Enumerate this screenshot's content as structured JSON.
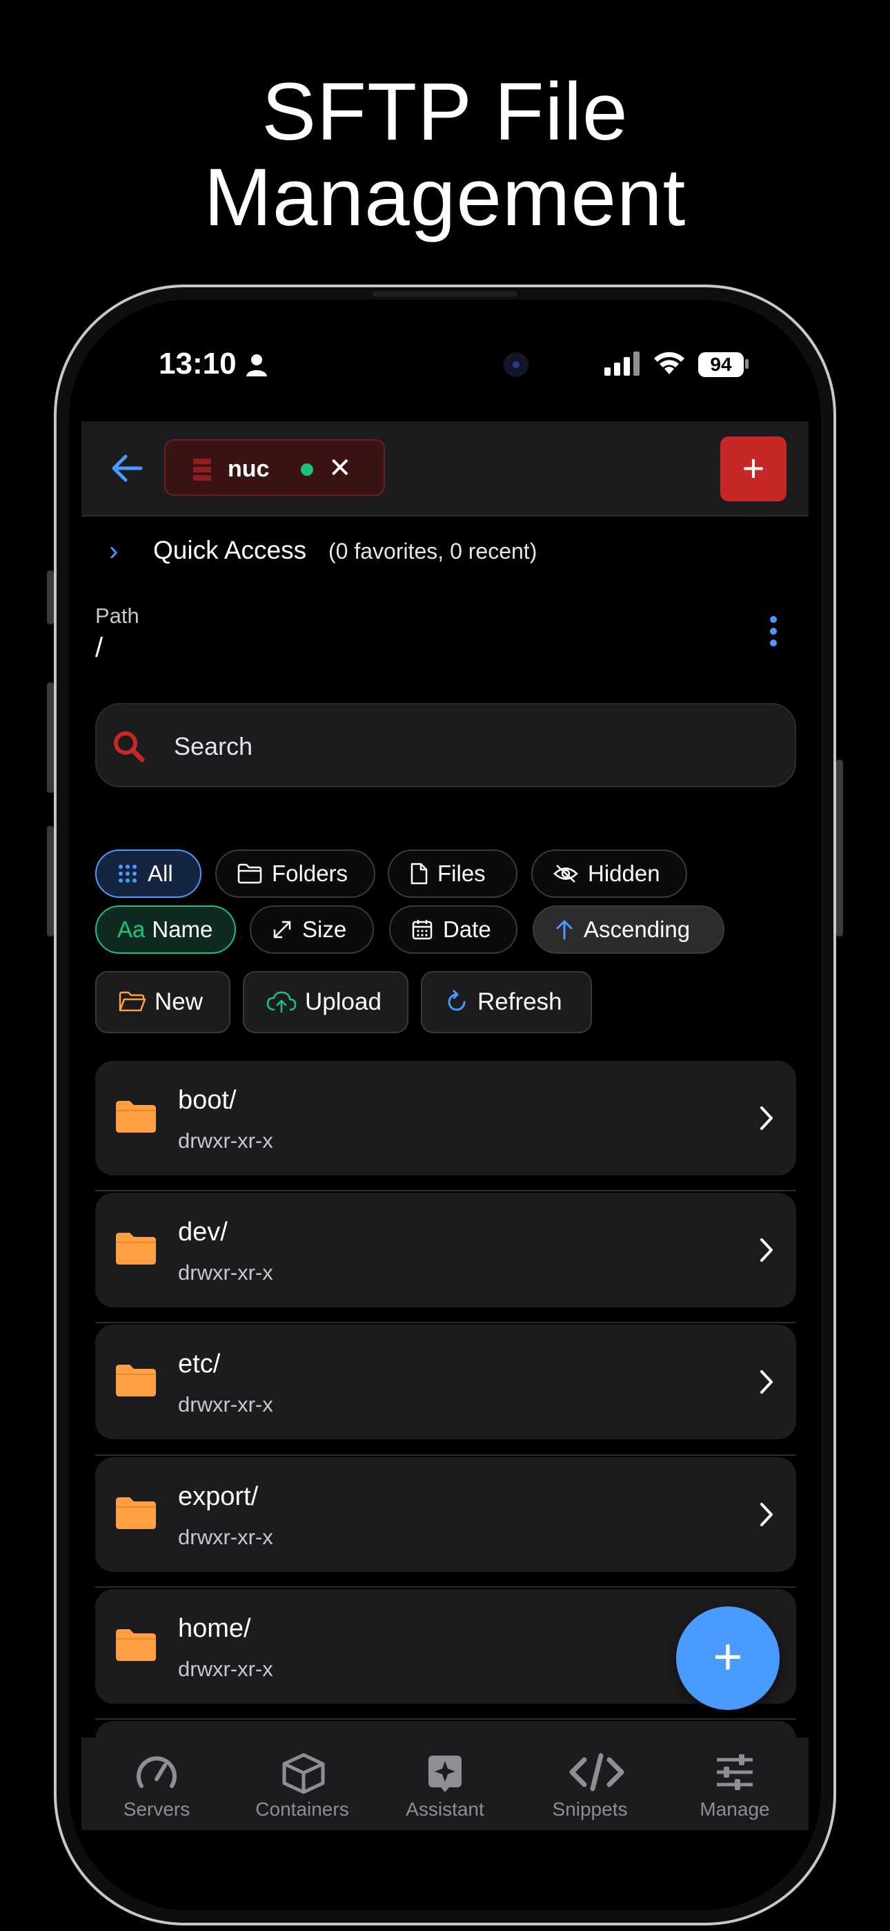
{
  "headline": {
    "line1": "SFTP File",
    "line2": "Management"
  },
  "status_bar": {
    "time": "13:10",
    "battery": "94"
  },
  "topbar": {
    "server_name": "nuc",
    "close_glyph": "✕",
    "add_glyph": "+",
    "back_icon": "arrow-left-icon"
  },
  "quick_access": {
    "title": "Quick Access",
    "subtitle": "(0 favorites, 0 recent)"
  },
  "path": {
    "label": "Path",
    "value": "/"
  },
  "search": {
    "placeholder": "Search"
  },
  "filters": {
    "all": "All",
    "folders": "Folders",
    "files": "Files",
    "hidden": "Hidden"
  },
  "sort": {
    "name_prefix": "Aa",
    "name": "Name",
    "size": "Size",
    "date": "Date",
    "order": "Ascending"
  },
  "actions": {
    "new": "New",
    "upload": "Upload",
    "refresh": "Refresh"
  },
  "entries": [
    {
      "name": "boot/",
      "perm": "drwxr-xr-x"
    },
    {
      "name": "dev/",
      "perm": "drwxr-xr-x"
    },
    {
      "name": "etc/",
      "perm": "drwxr-xr-x"
    },
    {
      "name": "export/",
      "perm": "drwxr-xr-x"
    },
    {
      "name": "home/",
      "perm": "drwxr-xr-x"
    }
  ],
  "fab": {
    "glyph": "+"
  },
  "tabs": [
    {
      "label": "Servers",
      "icon": "gauge-icon"
    },
    {
      "label": "Containers",
      "icon": "box-icon"
    },
    {
      "label": "Assistant",
      "icon": "sparkle-icon"
    },
    {
      "label": "Snippets",
      "icon": "code-icon"
    },
    {
      "label": "Manage",
      "icon": "sliders-icon"
    }
  ],
  "colors": {
    "accent": "#4a9bff",
    "danger": "#c62828",
    "online": "#1bc27a",
    "folder": "#ff9f43"
  }
}
